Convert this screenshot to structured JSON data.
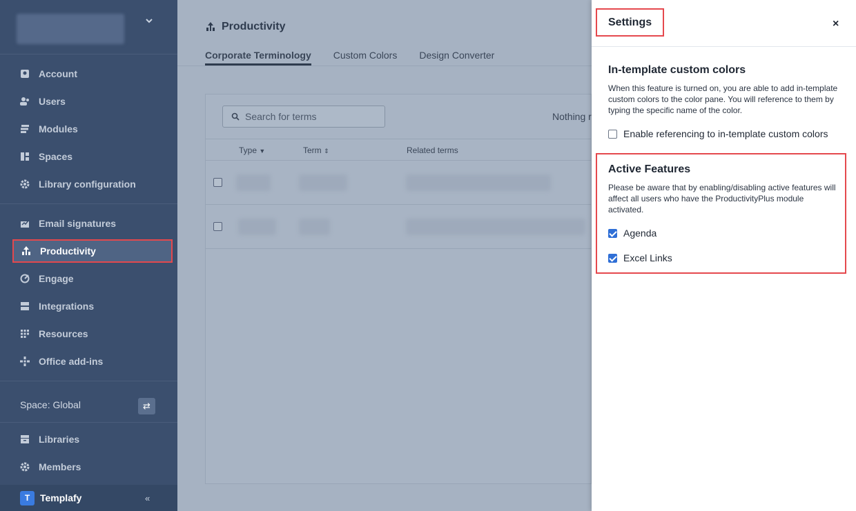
{
  "sidebar": {
    "items_top": [
      {
        "label": "Account",
        "icon": "account-icon"
      },
      {
        "label": "Users",
        "icon": "users-icon"
      },
      {
        "label": "Modules",
        "icon": "modules-icon"
      },
      {
        "label": "Spaces",
        "icon": "spaces-icon"
      },
      {
        "label": "Library configuration",
        "icon": "gear-icon"
      }
    ],
    "items_mid": [
      {
        "label": "Email signatures",
        "icon": "email-signature-icon"
      },
      {
        "label": "Productivity",
        "icon": "productivity-icon",
        "active": true
      },
      {
        "label": "Engage",
        "icon": "engage-icon"
      },
      {
        "label": "Integrations",
        "icon": "integrations-icon"
      },
      {
        "label": "Resources",
        "icon": "resources-icon"
      },
      {
        "label": "Office add-ins",
        "icon": "office-addins-icon"
      }
    ],
    "space_label": "Space: Global",
    "items_space": [
      {
        "label": "Libraries",
        "icon": "libraries-icon"
      },
      {
        "label": "Members",
        "icon": "gear-icon"
      }
    ],
    "brand_letter": "T",
    "brand": "Templafy",
    "collapse": "«"
  },
  "main": {
    "title": "Productivity",
    "tabs": [
      {
        "label": "Corporate Terminology",
        "active": true
      },
      {
        "label": "Custom Colors"
      },
      {
        "label": "Design Converter"
      }
    ],
    "search_placeholder": "Search for terms",
    "nothing_text": "Nothing r",
    "columns": {
      "type": "Type",
      "term": "Term",
      "related": "Related terms"
    }
  },
  "settings": {
    "title": "Settings",
    "close": "×",
    "custom_colors": {
      "title": "In-template custom colors",
      "text": "When this feature is turned on, you are able to add in-template custom colors to the color pane. You will reference to them by typing the specific name of the color.",
      "option": "Enable referencing to in-template custom colors"
    },
    "active_features": {
      "title": "Active Features",
      "text": "Please be aware that by enabling/disabling active features will affect all users who have the ProductivityPlus module activated.",
      "options": [
        {
          "label": "Agenda",
          "checked": true
        },
        {
          "label": "Excel Links",
          "checked": true
        }
      ]
    }
  },
  "colors": {
    "sidebar": "#3b4f6e",
    "accent": "#2f6fd6",
    "highlight": "#e5484d"
  }
}
